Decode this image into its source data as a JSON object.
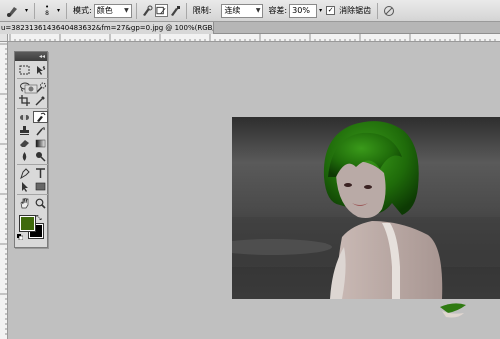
{
  "options_bar": {
    "brush_size": "8",
    "mode_label": "模式:",
    "mode_value": "颜色",
    "limit_label": "限制:",
    "limit_value": "连续",
    "tolerance_label": "容差:",
    "tolerance_value": "30%",
    "antialias_label": "消除锯齿",
    "antialias_checked": true
  },
  "document": {
    "tab_title": "u=3823136143640483632&fm=27&gp=0.jpg @ 100%(RGB/8#) *",
    "close_glyph": "×"
  },
  "tools": {
    "fg_color": "#3f6a0c",
    "bg_color": "#000000",
    "items": [
      "rectangular-marquee",
      "move",
      "lasso",
      "quick-selection",
      "crop",
      "eyedropper",
      "spot-healing",
      "color-replacement",
      "clone-stamp",
      "history-brush",
      "eraser",
      "gradient",
      "blur",
      "dodge",
      "pen",
      "type",
      "path-selection",
      "rectangle",
      "hand",
      "zoom"
    ],
    "active": "color-replacement"
  },
  "colors": {
    "workspace": "#c0c0c0",
    "hair_green": "#2f7a12"
  }
}
